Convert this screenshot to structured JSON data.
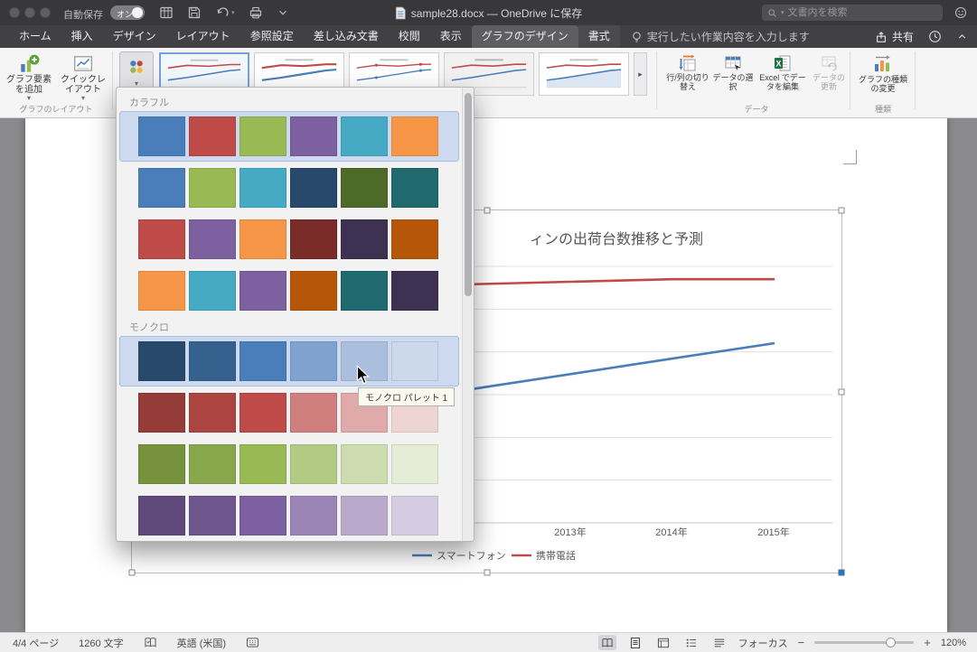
{
  "titlebar": {
    "autosave_label": "自動保存",
    "autosave_state": "オン",
    "doc_title": "sample28.docx — OneDrive に保存",
    "search_placeholder": "文書内を検索"
  },
  "tab_bar": {
    "tabs": [
      {
        "label": "ホーム"
      },
      {
        "label": "挿入"
      },
      {
        "label": "デザイン"
      },
      {
        "label": "レイアウト"
      },
      {
        "label": "参照設定"
      },
      {
        "label": "差し込み文書"
      },
      {
        "label": "校閲"
      },
      {
        "label": "表示"
      },
      {
        "label": "グラフのデザイン",
        "selected": true,
        "contextual": true
      },
      {
        "label": "書式",
        "contextual": true
      }
    ],
    "assistant_prompt": "実行したい作業内容を入力します",
    "share_label": "共有"
  },
  "ribbon": {
    "add_chart_element": "グラフ要素を追加",
    "quick_layout": "クイックレイアウト",
    "layout_group": "グラフのレイアウト",
    "switch_row_col": "行/列の切り替え",
    "select_data": "データの選択",
    "edit_in_excel": "Excel でデータを編集",
    "refresh_data": "データの更新",
    "data_group": "データ",
    "change_chart_type": "グラフの種類の変更",
    "type_group": "種類"
  },
  "palette": {
    "tooltip": "モノクロ パレット 1",
    "sections": [
      {
        "label": "カラフル",
        "rows": [
          {
            "selected": true,
            "colors": [
              "#4A7EBB",
              "#BE4B48",
              "#98B954",
              "#7D60A0",
              "#46AAC5",
              "#F79646"
            ]
          },
          {
            "colors": [
              "#4A7EBB",
              "#98B954",
              "#46AAC5",
              "#27496B",
              "#4E6A29",
              "#20696E"
            ]
          },
          {
            "colors": [
              "#BE4B48",
              "#7D60A0",
              "#F79646",
              "#7A2C29",
              "#3F3151",
              "#B65608"
            ]
          },
          {
            "colors": [
              "#F79646",
              "#46AAC5",
              "#7D60A0",
              "#B65608",
              "#20696E",
              "#3F3151"
            ]
          }
        ]
      },
      {
        "label": "モノクロ",
        "rows": [
          {
            "hover": true,
            "colors": [
              "#27496B",
              "#35618F",
              "#4A7EBB",
              "#80A2CE",
              "#AABFDE",
              "#CCD8EB"
            ]
          },
          {
            "colors": [
              "#953B38",
              "#AC4542",
              "#BE4B48",
              "#CF7F7D",
              "#DFAAA9",
              "#EED4D3"
            ]
          },
          {
            "colors": [
              "#77923D",
              "#88A64B",
              "#98B954",
              "#B2CB84",
              "#CCDCAE",
              "#E5EDD6"
            ]
          },
          {
            "colors": [
              "#5F4A7B",
              "#6E558E",
              "#7D60A0",
              "#9B85B6",
              "#B9AACC",
              "#D6CCE2"
            ]
          }
        ]
      }
    ]
  },
  "chart_data": {
    "type": "line",
    "title": "ィンの出荷台数推移と予測",
    "categories": [
      "2013年",
      "2014年",
      "2015年"
    ],
    "series": [
      {
        "name": "スマートフォン",
        "color": "#4A7EBB",
        "values": [
          58,
          64,
          70
        ]
      },
      {
        "name": "携帯電話",
        "color": "#BE4B48",
        "values": [
          94,
          95,
          95
        ]
      }
    ],
    "ylim": [
      0,
      100
    ],
    "grid": true,
    "legend_position": "bottom"
  },
  "statusbar": {
    "page_count": "4/4 ページ",
    "word_count": "1260 文字",
    "language": "英語 (米国)",
    "focus_label": "フォーカス",
    "zoom_level": "120%"
  }
}
